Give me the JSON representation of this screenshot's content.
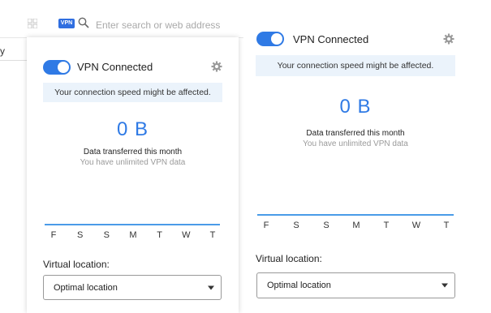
{
  "browser": {
    "vpn_badge": "VPN",
    "search_placeholder": "Enter search or web address",
    "bg_letter": "y"
  },
  "popups": [
    {
      "status": "VPN Connected",
      "notice": "Your connection speed might be affected.",
      "transferred_value": "0 B",
      "transferred_label": "Data transferred this month",
      "unlimited_text": "You have unlimited VPN data",
      "days": [
        "F",
        "S",
        "S",
        "M",
        "T",
        "W",
        "T"
      ],
      "location_label": "Virtual location:",
      "location_value": "Optimal location"
    },
    {
      "status": "VPN Connected",
      "notice": "Your connection speed might be affected.",
      "transferred_value": "0 B",
      "transferred_label": "Data transferred this month",
      "unlimited_text": "You have unlimited VPN data",
      "days": [
        "F",
        "S",
        "S",
        "M",
        "T",
        "W",
        "T"
      ],
      "location_label": "Virtual location:",
      "location_value": "Optimal location"
    }
  ],
  "colors": {
    "accent": "#2f7ae5",
    "notice_bg": "#ebf3fb"
  },
  "icons": [
    "grid-icon",
    "search-icon",
    "gear-icon",
    "chevron-down-icon"
  ]
}
